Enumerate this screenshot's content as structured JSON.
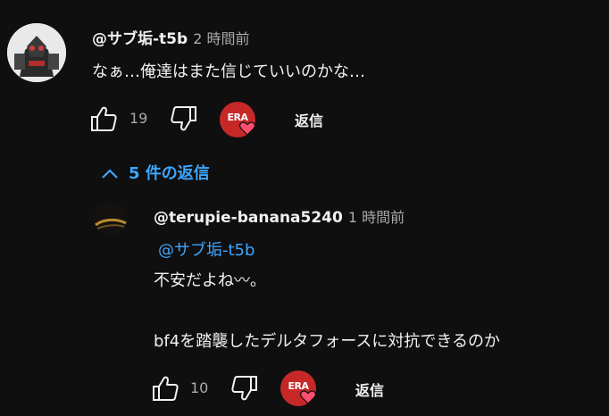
{
  "top_comment": {
    "author": "@サブ垢-t5b",
    "time": "2 時間前",
    "text": "なぁ…俺達はまた信じていいのかな…",
    "likes": "19",
    "reply_label": "返信",
    "creator_badge_text": "ERA"
  },
  "replies_toggle": {
    "label": "5 件の返信"
  },
  "reply": {
    "author": "@terupie-banana5240",
    "time": "1 時間前",
    "mention": "@サブ垢-t5b",
    "line1": "不安だよね〰。",
    "line2": "bf4を踏襲したデルタフォースに対抗できるのか",
    "likes": "10",
    "reply_label": "返信",
    "creator_badge_text": "ERA"
  },
  "colors": {
    "background": "#0f0f0f",
    "link": "#3ea6ff",
    "badge": "#c62828",
    "heart": "#ff4e6e"
  }
}
